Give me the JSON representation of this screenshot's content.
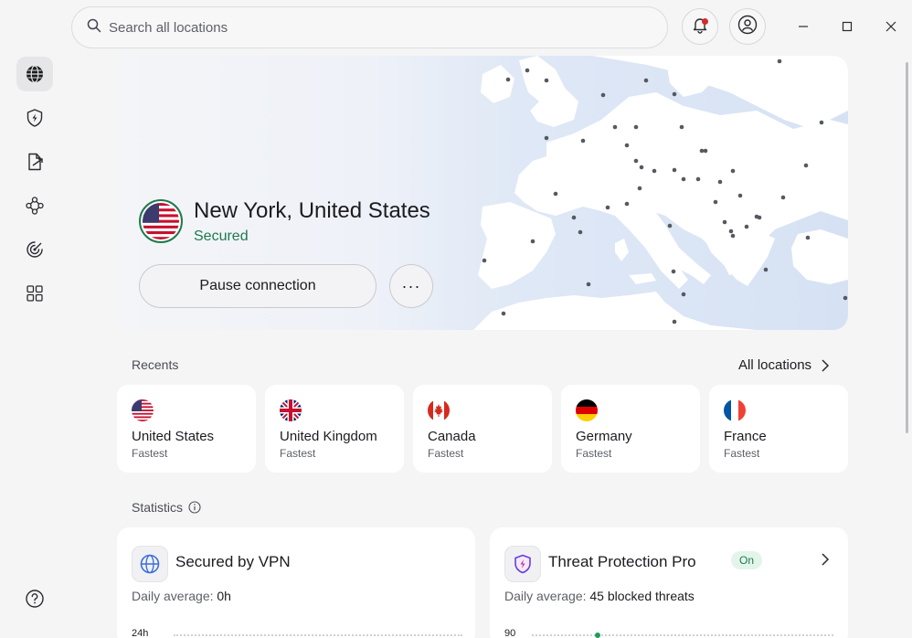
{
  "search": {
    "placeholder": "Search all locations"
  },
  "sidebar": {
    "items": [
      {
        "name": "globe-icon",
        "active": true
      },
      {
        "name": "shield-bolt-icon",
        "active": false
      },
      {
        "name": "split-tunnel-icon",
        "active": false
      },
      {
        "name": "meshnet-icon",
        "active": false
      },
      {
        "name": "radar-icon",
        "active": false
      },
      {
        "name": "apps-grid-icon",
        "active": false
      }
    ],
    "help_icon": "help-icon"
  },
  "hero": {
    "location": "New York, United States",
    "status": "Secured",
    "pause_label": "Pause connection",
    "more_label": "···"
  },
  "recents": {
    "label": "Recents",
    "all_locations": "All locations",
    "items": [
      {
        "country": "United States",
        "sub": "Fastest"
      },
      {
        "country": "United Kingdom",
        "sub": "Fastest"
      },
      {
        "country": "Canada",
        "sub": "Fastest"
      },
      {
        "country": "Germany",
        "sub": "Fastest"
      },
      {
        "country": "France",
        "sub": "Fastest"
      }
    ]
  },
  "statistics": {
    "label": "Statistics",
    "vpn": {
      "title": "Secured by VPN",
      "avg_label": "Daily average:",
      "avg_value": "0h",
      "axis_top": "24h"
    },
    "threat": {
      "title": "Threat Protection Pro",
      "badge": "On",
      "avg_label": "Daily average:",
      "avg_value": "45 blocked threats",
      "axis_top": "90"
    }
  },
  "colors": {
    "accent_green": "#1f7a4d",
    "notification_red": "#d62b2b",
    "map_sea": "#d6e2f4",
    "map_land": "#ffffff"
  }
}
